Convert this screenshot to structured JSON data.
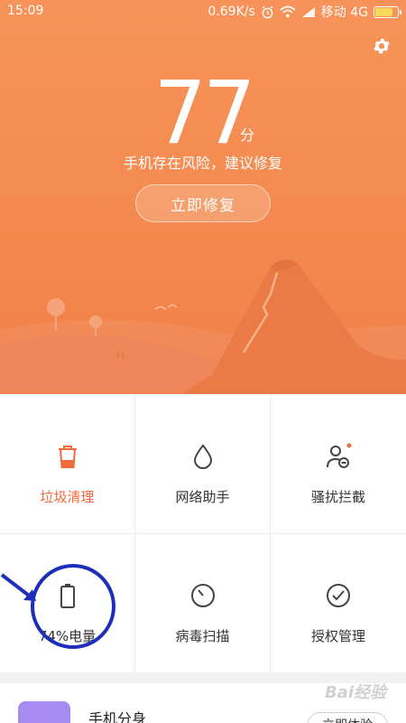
{
  "status_bar": {
    "time": "15:09",
    "net_speed": "0.69K/s",
    "carrier": "移动 4G",
    "battery_level": 0.74
  },
  "header": {
    "score": "77",
    "score_unit": "分",
    "subtitle": "手机存在风险，建议修复",
    "fix_button": "立即修复",
    "gear_icon": "gear-icon",
    "colors": {
      "bg": "#f48a4f",
      "accent": "#f06a3c"
    }
  },
  "grid": {
    "items": [
      {
        "label": "垃圾清理",
        "icon": "trash-icon"
      },
      {
        "label": "网络助手",
        "icon": "droplet-icon"
      },
      {
        "label": "骚扰拦截",
        "icon": "user-block-icon"
      },
      {
        "label": "74%电量",
        "icon": "battery-icon"
      },
      {
        "label": "病毒扫描",
        "icon": "scan-timer-icon"
      },
      {
        "label": "授权管理",
        "icon": "check-circle-icon"
      }
    ]
  },
  "bottom": {
    "title": "手机分身",
    "button": "立即体验"
  },
  "watermark": "Bai经验"
}
